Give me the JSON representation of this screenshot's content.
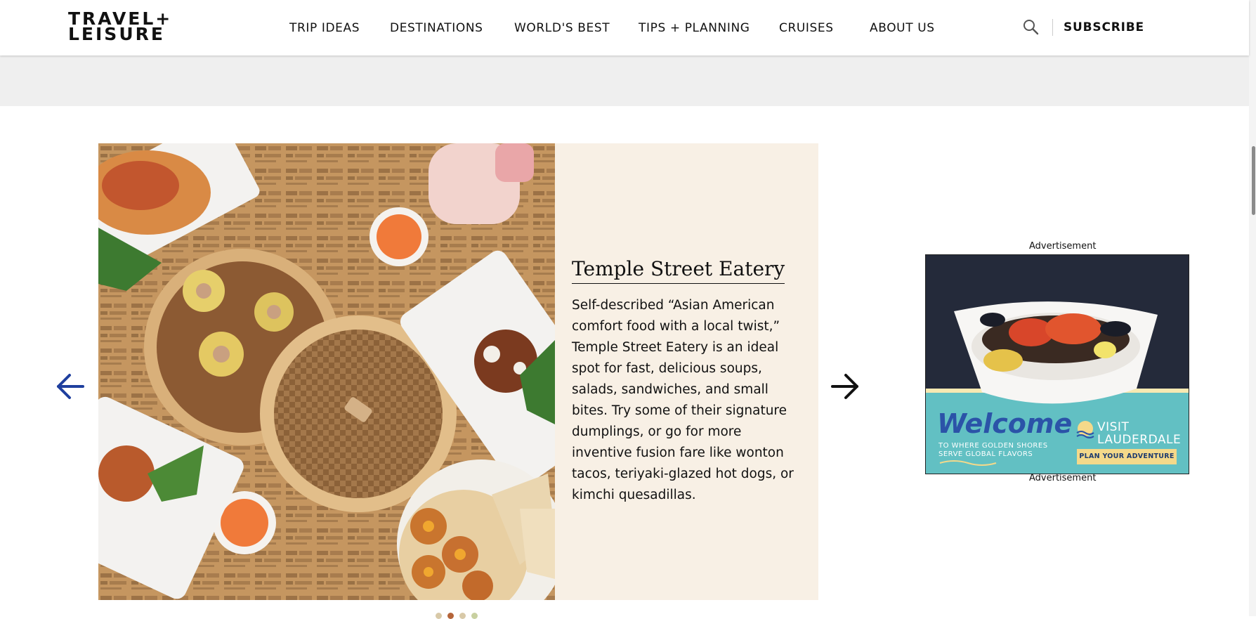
{
  "brand": {
    "logo_line1": "TRAVEL+",
    "logo_line2": "LEISURE"
  },
  "nav": {
    "items": [
      {
        "label": "TRIP IDEAS"
      },
      {
        "label": "DESTINATIONS"
      },
      {
        "label": "WORLD'S BEST"
      },
      {
        "label": "TIPS + PLANNING"
      },
      {
        "label": "CRUISES"
      },
      {
        "label": "ABOUT US"
      }
    ],
    "subscribe_label": "SUBSCRIBE"
  },
  "slide": {
    "title": "Temple Street Eatery",
    "description": "Self-described “Asian American comfort food with a local twist,” Temple Street Eatery is an ideal spot for fast, delicious soups, salads, sandwiches, and small bites. Try some of their signature dumplings, or go for more inventive fusion fare like wonton tacos, teriyaki-glazed hot dogs, or kimchi quesadillas."
  },
  "ad": {
    "label_top": "Advertisement",
    "label_bottom": "Advertisement",
    "headline": "Welcome",
    "tagline": "TO WHERE GOLDEN SHORES SERVE GLOBAL FLAVORS",
    "brand_line1": "VISIT",
    "brand_line2": "LAUDERDALE",
    "cta": "PLAN YOUR ADVENTURE"
  },
  "carousel": {
    "dot_count": 4,
    "active_dot": 2
  },
  "colors": {
    "panel_bg": "#f8f0e5",
    "prev_arrow": "#1f3f9e",
    "next_arrow": "#111111",
    "ad_blue": "#2b53a8",
    "ad_teal": "#62c0c3"
  }
}
